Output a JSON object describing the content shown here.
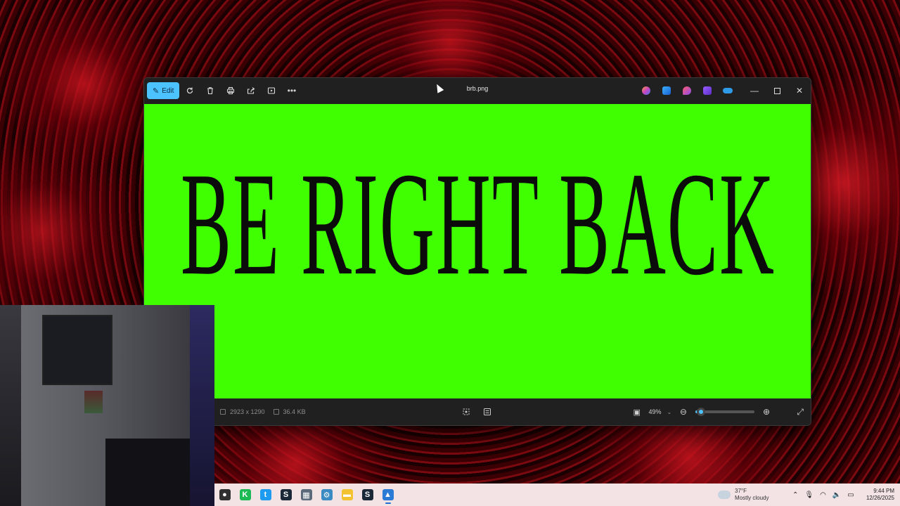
{
  "window": {
    "title": "brb.png",
    "edit_label": "Edit",
    "toolbar_icons": [
      "rotate-icon",
      "delete-icon",
      "print-icon",
      "share-icon",
      "slideshow-icon",
      "more-icon"
    ],
    "app_icons": [
      "copilot-icon",
      "designer-icon",
      "clipchamp-icon",
      "video-editor-icon",
      "onedrive-icon"
    ]
  },
  "image": {
    "text": "BE RIGHT BACK",
    "background_color": "#3fff00"
  },
  "status": {
    "dimensions": "2923 x 1290",
    "file_size": "36.4 KB",
    "zoom_value": "49%",
    "zoom_fraction": 0.1
  },
  "taskbar": {
    "apps": [
      {
        "name": "obs",
        "glyph": "●",
        "color": "#303030"
      },
      {
        "name": "kick",
        "glyph": "K",
        "color": "#1db954"
      },
      {
        "name": "twitter",
        "glyph": "t",
        "color": "#1d9bf0"
      },
      {
        "name": "steam",
        "glyph": "S",
        "color": "#1b2838"
      },
      {
        "name": "calculator",
        "glyph": "▦",
        "color": "#5a6a7a"
      },
      {
        "name": "settings",
        "glyph": "⚙",
        "color": "#3a8ac4"
      },
      {
        "name": "file-explorer",
        "glyph": "▬",
        "color": "#f2c230"
      },
      {
        "name": "steam-2",
        "glyph": "S",
        "color": "#1b2838"
      },
      {
        "name": "photos",
        "glyph": "▲",
        "color": "#2a7bd6"
      }
    ],
    "weather_temp": "37°F",
    "weather_desc": "Mostly cloudy",
    "time": "9:44 PM",
    "date": "12/26/2025"
  }
}
